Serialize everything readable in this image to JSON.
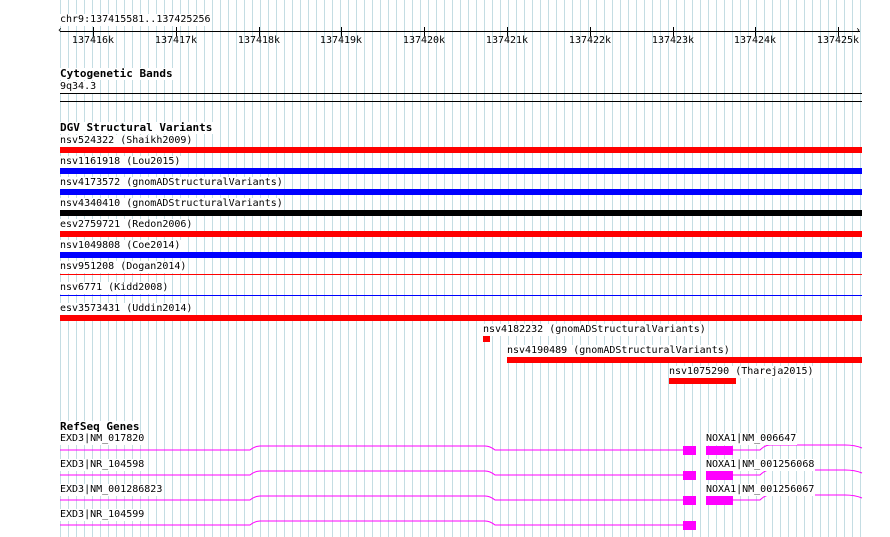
{
  "ruler": {
    "range_label": "chr9:137415581..137425256",
    "ticks": [
      "137416k",
      "137417k",
      "137418k",
      "137419k",
      "137420k",
      "137421k",
      "137422k",
      "137423k",
      "137424k",
      "137425k"
    ]
  },
  "cyto": {
    "title": "Cytogenetic Bands",
    "band": "9q34.3"
  },
  "dgv": {
    "title": "DGV Structural Variants",
    "rows": [
      {
        "label": "nsv524322 (Shaikh2009)",
        "color": "#ff0000"
      },
      {
        "label": "nsv1161918 (Lou2015)",
        "color": "#0000ff"
      },
      {
        "label": "nsv4173572 (gnomADStructuralVariants)",
        "color": "#0000ff"
      },
      {
        "label": "nsv4340410 (gnomADStructuralVariants)",
        "color": "#000000"
      },
      {
        "label": "esv2759721 (Redon2006)",
        "color": "#ff0000"
      },
      {
        "label": "nsv1049808 (Coe2014)",
        "color": "#0000ff"
      },
      {
        "label": "nsv951208 (Dogan2014)",
        "color": "#ff0000"
      },
      {
        "label": "nsv6771 (Kidd2008)",
        "color": "#0000ff"
      },
      {
        "label": "esv3573431 (Uddin2014)",
        "color": "#ff0000"
      },
      {
        "label": "nsv4182232 (gnomADStructuralVariants)",
        "color": "#ff0000"
      },
      {
        "label": "nsv4190489 (gnomADStructuralVariants)",
        "color": "#ff0000"
      },
      {
        "label": "nsv1075290 (Thareja2015)",
        "color": "#ff0000"
      }
    ]
  },
  "refseq": {
    "title": "RefSeq Genes",
    "color": "#ff00ff",
    "genes": [
      {
        "left_label": "EXD3|NM_017820",
        "right_label": "NOXA1|NM_006647"
      },
      {
        "left_label": "EXD3|NR_104598",
        "right_label": "NOXA1|NM_001256068"
      },
      {
        "left_label": "EXD3|NM_001286823",
        "right_label": "NOXA1|NM_001256067"
      },
      {
        "left_label": "EXD3|NR_104599",
        "right_label": ""
      }
    ]
  }
}
